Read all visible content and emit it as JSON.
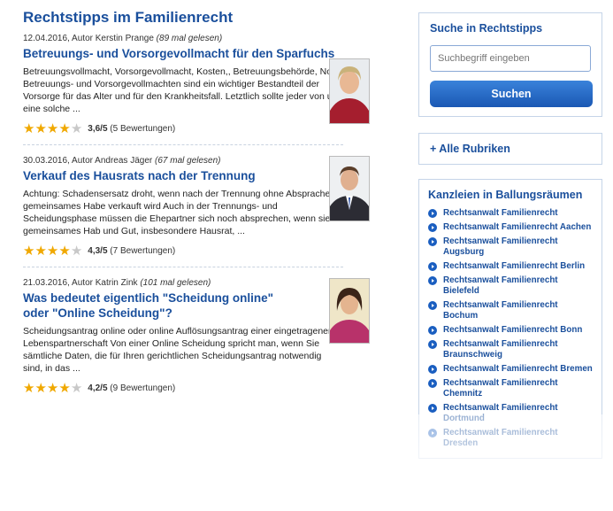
{
  "main": {
    "heading": "Rechtstipps im Familienrecht",
    "articles": [
      {
        "date_author": "12.04.2016, Autor Kerstin Prange",
        "reads": "(89 mal gelesen)",
        "title": "Betreuungs- und Vorsorgevollmacht für den Sparfuchs",
        "excerpt": "Betreuungsvollmacht, Vorsorgevollmacht, Kosten,, Betreuungsbehörde, Notar Betreuungs- und Vorsorgevollmachten sind ein wichtiger Bestandteil der Vorsorge für das Alter und für den Krankheitsfall. Letztlich sollte jeder von uns eine solche ...",
        "rating": "3,6/5",
        "reviews": "(5 Bewertungen)",
        "stars": 3.6
      },
      {
        "date_author": "30.03.2016, Autor Andreas Jäger",
        "reads": "(67 mal gelesen)",
        "title": "Verkauf des Hausrats nach der Trennung",
        "excerpt": "Achtung: Schadensersatz droht, wenn nach der Trennung ohne Absprache gemeinsames Habe verkauft wird Auch in der Trennungs- und Scheidungsphase müssen die Ehepartner sich noch absprechen, wenn sie gemeinsames Hab und Gut, insbesondere Hausrat, ...",
        "rating": "4,3/5",
        "reviews": "(7 Bewertungen)",
        "stars": 4.3
      },
      {
        "date_author": "21.03.2016, Autor Katrin Zink",
        "reads": "(101 mal gelesen)",
        "title": "Was bedeutet eigentlich \"Scheidung online\" oder \"Online Scheidung\"?",
        "excerpt": "Scheidungsantrag online oder online Auflösungsantrag einer eingetragenen Lebenspartnerschaft Von einer Online Scheidung spricht man, wenn Sie sämtliche Daten, die für Ihren gerichtlichen Scheidungsantrag notwendig sind, in das ...",
        "rating": "4,2/5",
        "reviews": "(9 Bewertungen)",
        "stars": 4.2
      }
    ]
  },
  "sidebar": {
    "search_title": "Suche in Rechtstipps",
    "search_placeholder": "Suchbegriff eingeben",
    "search_button": "Suchen",
    "rubriken_label": "+ Alle Rubriken",
    "kanzleien_title": "Kanzleien in Ballungsräumen",
    "kanzleien": [
      "Rechtsanwalt Familienrecht",
      "Rechtsanwalt Familienrecht Aachen",
      "Rechtsanwalt Familienrecht Augsburg",
      "Rechtsanwalt Familienrecht Berlin",
      "Rechtsanwalt Familienrecht Bielefeld",
      "Rechtsanwalt Familienrecht Bochum",
      "Rechtsanwalt Familienrecht Bonn",
      "Rechtsanwalt Familienrecht Braunschweig",
      "Rechtsanwalt Familienrecht Bremen",
      "Rechtsanwalt Familienrecht Chemnitz",
      "Rechtsanwalt Familienrecht Dortmund",
      "Rechtsanwalt Familienrecht Dresden"
    ]
  },
  "colors": {
    "accent": "#1a4f9c",
    "star": "#f0a800",
    "button": "#1a58b4"
  }
}
